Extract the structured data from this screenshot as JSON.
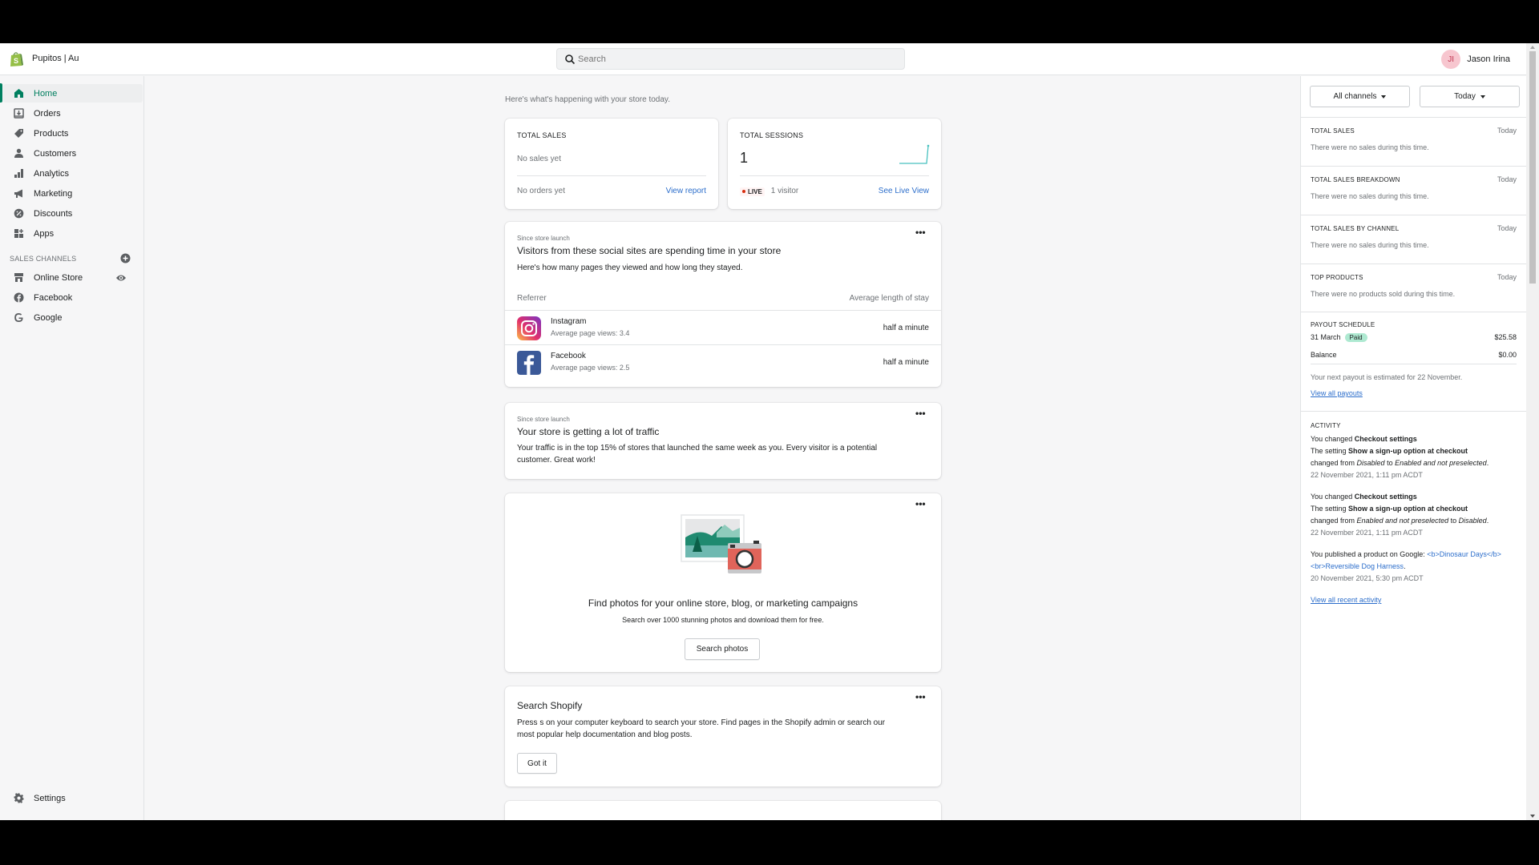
{
  "topbar": {
    "store_name": "Pupitos | Au",
    "search_placeholder": "Search",
    "user_initials": "JI",
    "user_name": "Jason Irina"
  },
  "sidebar": {
    "items": [
      {
        "label": "Home",
        "icon": "home-icon",
        "active": true
      },
      {
        "label": "Orders",
        "icon": "orders-icon"
      },
      {
        "label": "Products",
        "icon": "tag-icon"
      },
      {
        "label": "Customers",
        "icon": "person-icon"
      },
      {
        "label": "Analytics",
        "icon": "bar-chart-icon"
      },
      {
        "label": "Marketing",
        "icon": "megaphone-icon"
      },
      {
        "label": "Discounts",
        "icon": "discount-icon"
      },
      {
        "label": "Apps",
        "icon": "apps-icon"
      }
    ],
    "sales_channels_heading": "SALES CHANNELS",
    "channels": [
      {
        "label": "Online Store",
        "icon": "store-icon"
      },
      {
        "label": "Facebook",
        "icon": "facebook-icon"
      },
      {
        "label": "Google",
        "icon": "google-icon"
      }
    ],
    "settings_label": "Settings"
  },
  "main": {
    "subtitle": "Here's what's happening with your store today.",
    "total_sales": {
      "label": "TOTAL SALES",
      "value": "No sales yet",
      "footer": "No orders yet",
      "link": "View report"
    },
    "total_sessions": {
      "label": "TOTAL SESSIONS",
      "value": "1",
      "live_label": "LIVE",
      "visitors": "1 visitor",
      "link": "See Live View"
    },
    "social_card": {
      "eyebrow": "Since store launch",
      "title": "Visitors from these social sites are spending time in your store",
      "description": "Here's how many pages they viewed and how long they stayed.",
      "col_referrer": "Referrer",
      "col_stay": "Average length of stay",
      "rows": [
        {
          "name": "Instagram",
          "sub": "Average page views: 3.4",
          "stay": "half a minute"
        },
        {
          "name": "Facebook",
          "sub": "Average page views: 2.5",
          "stay": "half a minute"
        }
      ]
    },
    "traffic_card": {
      "eyebrow": "Since store launch",
      "title": "Your store is getting a lot of traffic",
      "text": "Your traffic is in the top 15% of stores that launched the same week as you. Every visitor is a potential customer. Great work!"
    },
    "photos_card": {
      "title": "Find photos for your online store, blog, or marketing campaigns",
      "subtitle": "Search over 1000 stunning photos and download them for free.",
      "button": "Search photos"
    },
    "search_card": {
      "title": "Search Shopify",
      "text": "Press s on your computer keyboard to search your store. Find pages in the Shopify admin or search our most popular help documentation and blog posts.",
      "button": "Got it"
    },
    "more_label": "•••"
  },
  "right_panel": {
    "channel_filter": "All channels",
    "date_filter": "Today",
    "sections": [
      {
        "heading": "TOTAL SALES",
        "when": "Today",
        "empty": "There were no sales during this time."
      },
      {
        "heading": "TOTAL SALES BREAKDOWN",
        "when": "Today",
        "empty": "There were no sales during this time."
      },
      {
        "heading": "TOTAL SALES BY CHANNEL",
        "when": "Today",
        "empty": "There were no sales during this time."
      },
      {
        "heading": "TOP PRODUCTS",
        "when": "Today",
        "empty": "There were no products sold during this time."
      }
    ],
    "payout": {
      "heading": "PAYOUT SCHEDULE",
      "date": "31 March",
      "status": "Paid",
      "amount": "$25.58",
      "balance_label": "Balance",
      "balance": "$0.00",
      "next": "Your next payout is estimated for 22 November.",
      "link": "View all payouts"
    },
    "activity": {
      "heading": "ACTIVITY",
      "items": [
        {
          "l1_pre": "You changed ",
          "l1_bold": "Checkout settings",
          "l2_pre": "The setting ",
          "l2_bold": "Show a sign-up option at checkout",
          "l3_pre": "changed from ",
          "l3_from": "Disabled",
          "l3_mid": " to ",
          "l3_to": "Enabled and not preselected",
          "l3_end": ".",
          "time": "22 November 2021, 1:11 pm ACDT"
        },
        {
          "l1_pre": "You changed ",
          "l1_bold": "Checkout settings",
          "l2_pre": "The setting ",
          "l2_bold": "Show a sign-up option at checkout",
          "l3_pre": "changed from ",
          "l3_from": "Enabled and not preselected",
          "l3_mid": " to ",
          "l3_to": "Disabled",
          "l3_end": ".",
          "time": "22 November 2021, 1:11 pm ACDT"
        },
        {
          "pre": "You published a product on Google: ",
          "link": "<b>Dinosaur Days</b> <br>Reversible Dog Harness",
          "end": ".",
          "time": "20 November 2021, 5:30 pm ACDT"
        }
      ],
      "link": "View all recent activity"
    }
  }
}
